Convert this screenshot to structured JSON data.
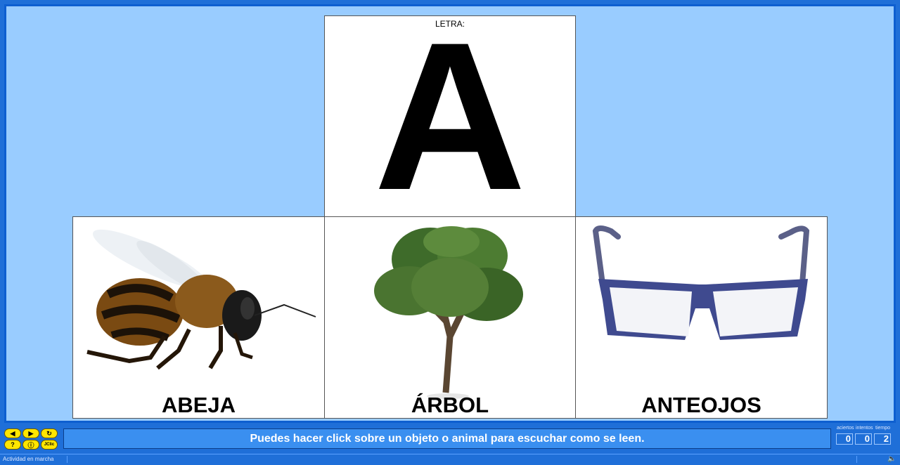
{
  "letter_panel": {
    "label": "LETRA:",
    "letter": "A"
  },
  "cards": [
    {
      "word": "ABEJA"
    },
    {
      "word": "ÁRBOL"
    },
    {
      "word": "ANTEOJOS"
    }
  ],
  "message": "Puedes hacer click sobre un objeto o animal para escuchar como se leen.",
  "nav_buttons": [
    "prev-icon",
    "next-icon",
    "restart-icon",
    "help-icon",
    "info-icon",
    "jclic-icon"
  ],
  "jclic_label": "JClic",
  "counters": {
    "aciertos_label": "aciertos",
    "aciertos": "0",
    "intentos_label": "intentos",
    "intentos": "0",
    "tiempo_label": "tiempo",
    "tiempo": "2"
  },
  "status_text": "Actividad en marcha",
  "colors": {
    "frame": "#1f6fd8",
    "stage": "#99ccff",
    "buttons": "#ffe600"
  }
}
